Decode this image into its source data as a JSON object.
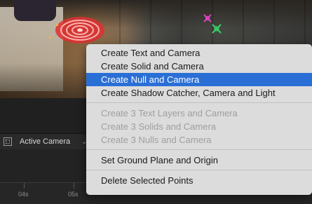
{
  "viewer": {
    "colors": {
      "target_ring": "#e03030",
      "track_pink": "#e040c0",
      "track_green": "#39d36a"
    }
  },
  "toolbar": {
    "camera_icon": "3d-view-icon",
    "view_label": "Active Camera",
    "chevron_icon": "chevron-down-icon",
    "chevron_glyph": "⌄"
  },
  "timeline": {
    "ticks": [
      "04s",
      "05s",
      "",
      "",
      "",
      "",
      "",
      ""
    ]
  },
  "context_menu": {
    "selected_color": "#2a6fd6",
    "groups": [
      {
        "items": [
          {
            "label": "Create Text and Camera",
            "enabled": true,
            "selected": false
          },
          {
            "label": "Create Solid and Camera",
            "enabled": true,
            "selected": false
          },
          {
            "label": "Create Null and Camera",
            "enabled": true,
            "selected": true
          },
          {
            "label": "Create Shadow Catcher, Camera and Light",
            "enabled": true,
            "selected": false
          }
        ]
      },
      {
        "items": [
          {
            "label": "Create 3 Text Layers and Camera",
            "enabled": false,
            "selected": false
          },
          {
            "label": "Create 3 Solids and Camera",
            "enabled": false,
            "selected": false
          },
          {
            "label": "Create 3 Nulls and Camera",
            "enabled": false,
            "selected": false
          }
        ]
      },
      {
        "items": [
          {
            "label": "Set Ground Plane and Origin",
            "enabled": true,
            "selected": false
          }
        ]
      },
      {
        "items": [
          {
            "label": "Delete Selected Points",
            "enabled": true,
            "selected": false
          }
        ]
      }
    ]
  }
}
